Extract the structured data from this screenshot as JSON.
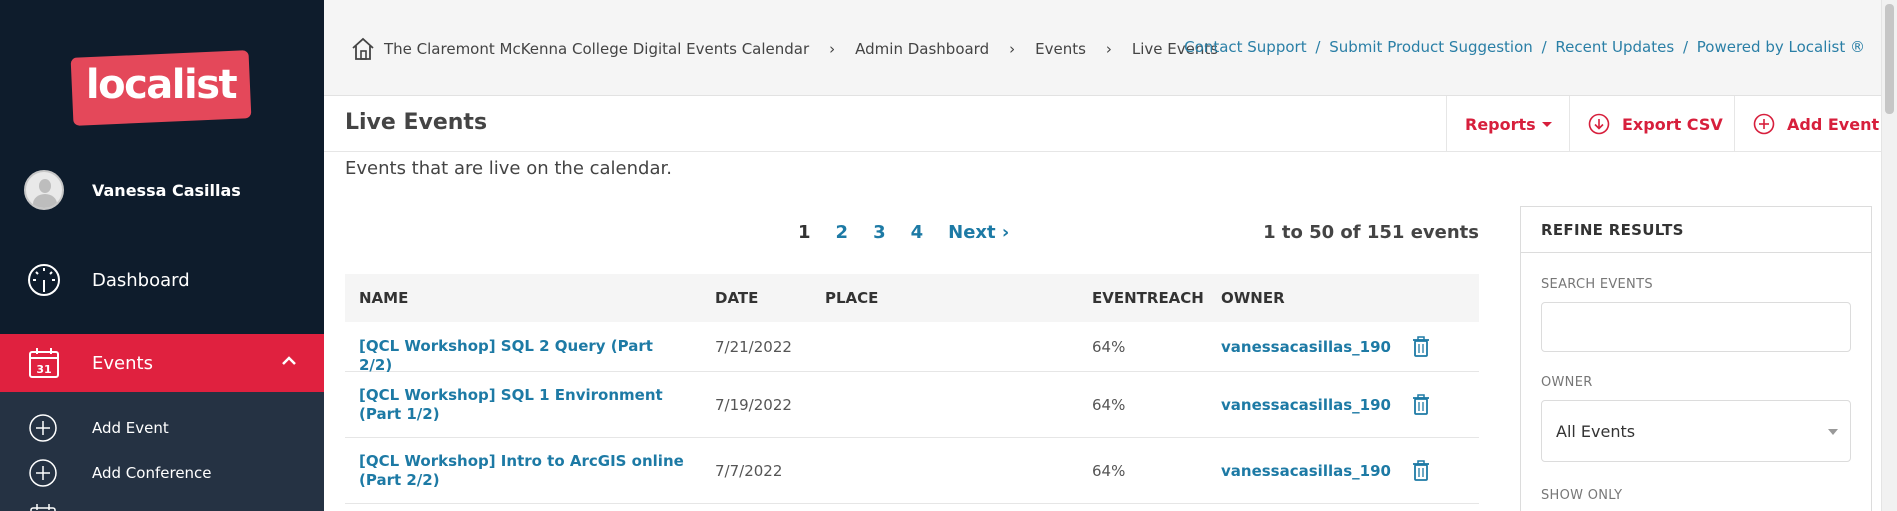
{
  "sidebar": {
    "logo_text": "localist",
    "user_name": "Vanessa Casillas",
    "nav": {
      "dashboard": "Dashboard",
      "events": "Events"
    },
    "subnav": [
      {
        "label": "Add Event"
      },
      {
        "label": "Add Conference"
      }
    ]
  },
  "topbar": {
    "breadcrumbs": [
      "The Claremont McKenna College Digital Events Calendar",
      "Admin Dashboard",
      "Events",
      "Live Events"
    ],
    "breadcrumb_separator": "›",
    "links": [
      "Contact Support",
      "Submit Product Suggestion",
      "Recent Updates",
      "Powered by Localist ®"
    ],
    "link_separator": "/"
  },
  "header": {
    "title": "Live Events",
    "reports_label": "Reports",
    "export_label": "Export CSV",
    "add_label": "Add Event"
  },
  "description": "Events that are live on the calendar.",
  "pagination": {
    "pages": [
      "1",
      "2",
      "3",
      "4"
    ],
    "next_label": "Next ›",
    "count_text": "1 to 50 of 151 events"
  },
  "table": {
    "columns": [
      "NAME",
      "DATE",
      "PLACE",
      "EVENTREACH",
      "OWNER"
    ],
    "rows": [
      {
        "name": "[QCL Workshop] SQL 2 Query (Part 2/2)",
        "date": "7/21/2022",
        "place": "",
        "reach": "64%",
        "owner": "vanessacasillas_190"
      },
      {
        "name": "[QCL Workshop] SQL 1 Environment (Part 1/2)",
        "date": "7/19/2022",
        "place": "",
        "reach": "64%",
        "owner": "vanessacasillas_190"
      },
      {
        "name": "[QCL Workshop] Intro to ArcGIS online (Part 2/2)",
        "date": "7/7/2022",
        "place": "",
        "reach": "64%",
        "owner": "vanessacasillas_190"
      }
    ]
  },
  "refine": {
    "title": "REFINE RESULTS",
    "search_label": "SEARCH EVENTS",
    "search_value": "",
    "owner_label": "OWNER",
    "owner_value": "All Events",
    "show_only_label": "SHOW ONLY"
  },
  "colors": {
    "sidebar_bg": "#0e1c2c",
    "accent_red": "#e0213f",
    "link_blue": "#1d7aa5"
  }
}
